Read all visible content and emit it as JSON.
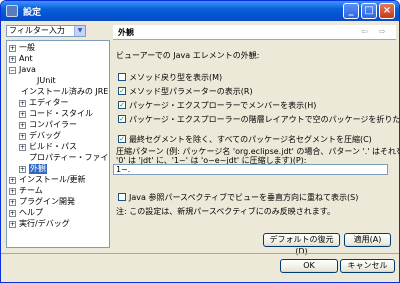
{
  "window": {
    "title": "設定",
    "minimize_glyph": "_",
    "maximize_glyph": "□",
    "close_glyph": "×"
  },
  "left": {
    "filter_placeholder": "フィルター入力",
    "tree": [
      {
        "label": "一般",
        "expander": "+"
      },
      {
        "label": "Ant",
        "expander": "+"
      },
      {
        "label": "Java",
        "expander": "−"
      },
      {
        "label": "JUnit",
        "expander": ""
      },
      {
        "label": "インストール済みの JRE",
        "expander": ""
      },
      {
        "label": "エディター",
        "expander": "+"
      },
      {
        "label": "コード・スタイル",
        "expander": "+"
      },
      {
        "label": "コンパイラー",
        "expander": "+"
      },
      {
        "label": "デバッグ",
        "expander": "+"
      },
      {
        "label": "ビルド・パス",
        "expander": "+"
      },
      {
        "label": "プロパティー・ファイル・エディター",
        "expander": ""
      },
      {
        "label": "外観",
        "expander": "+"
      },
      {
        "label": "インストール/更新",
        "expander": "+"
      },
      {
        "label": "チーム",
        "expander": "+"
      },
      {
        "label": "プラグイン開発",
        "expander": "+"
      },
      {
        "label": "ヘルプ",
        "expander": "+"
      },
      {
        "label": "実行/デバッグ",
        "expander": "+"
      }
    ]
  },
  "page": {
    "title": "外観",
    "nav_back": "⇦",
    "nav_fwd": "⇨",
    "intro": "ビューアーでの Java エレメントの外観:",
    "options": [
      {
        "label": "メソッド戻り型を表示(M)",
        "checked": false
      },
      {
        "label": "メソッド型パラメーターの表示(R)",
        "checked": true
      },
      {
        "label": "パッケージ・エクスプローラーでメンバーを表示(H)",
        "checked": true
      },
      {
        "label": "パッケージ・エクスプローラーの階層レイアウトで空のパッケージを折りたたみ(E)",
        "checked": true
      },
      {
        "label": "最終セグメントを除く、すべてのパッケージ名セグメントを圧縮(C)",
        "checked": true
      }
    ],
    "compress_desc_1": "圧縮パターン (例: パッケージ名 'org.eclipse.jdt' の場合、パターン '.' はそれを '..jdt' に、",
    "compress_desc_2": "'0' は 'jdt' に、'1~' は 'o~e~jdt' に圧縮します)(P):",
    "compress_value": "1~.",
    "vertical_option": {
      "label": "Java 参照パースペクティブでビューを垂直方向に重ねて表示(S)",
      "checked": false
    },
    "note": "注: この設定は、新規パースペクティブにのみ反映されます。",
    "restore_button": "デフォルトの復元(D)",
    "apply_button": "適用(A)"
  },
  "footer": {
    "ok_button": "OK",
    "cancel_button": "キャンセル"
  }
}
